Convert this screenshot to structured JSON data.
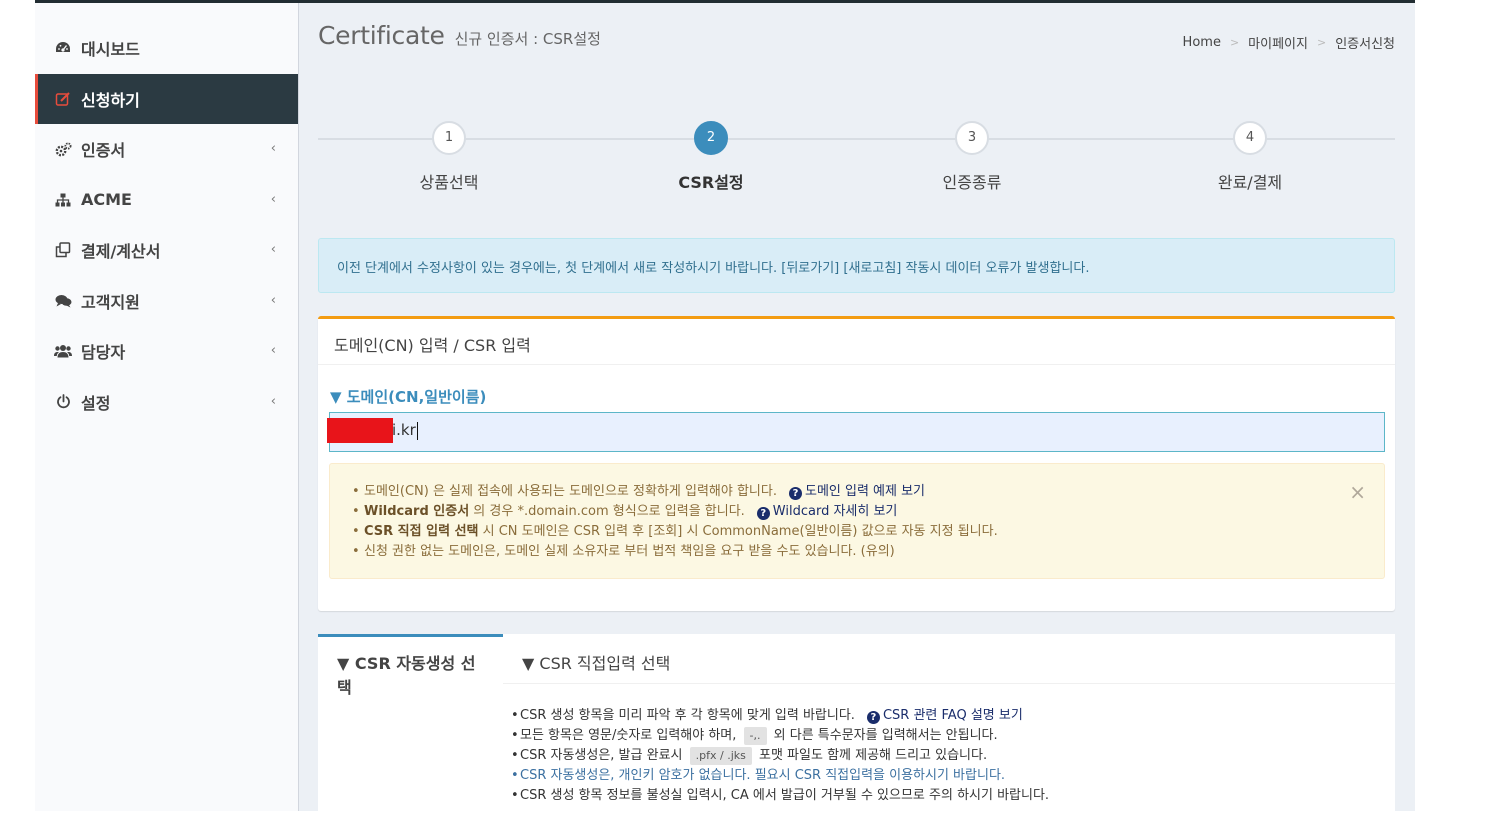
{
  "sidebar": {
    "items": [
      {
        "label": "대시보드",
        "icon": "dashboard-icon",
        "active": false,
        "has_submenu": false
      },
      {
        "label": "신청하기",
        "icon": "edit-icon",
        "active": true,
        "has_submenu": false
      },
      {
        "label": "인증서",
        "icon": "cogs-icon",
        "active": false,
        "has_submenu": true
      },
      {
        "label": "ACME",
        "icon": "sitemap-icon",
        "active": false,
        "has_submenu": true
      },
      {
        "label": "결제/계산서",
        "icon": "clone-icon",
        "active": false,
        "has_submenu": true
      },
      {
        "label": "고객지원",
        "icon": "comments-icon",
        "active": false,
        "has_submenu": true
      },
      {
        "label": "담당자",
        "icon": "users-icon",
        "active": false,
        "has_submenu": true
      },
      {
        "label": "설정",
        "icon": "power-icon",
        "active": false,
        "has_submenu": true
      }
    ],
    "chevron": "‹"
  },
  "header": {
    "title": "Certificate",
    "subtitle": "신규 인증서 : CSR설정",
    "breadcrumb": [
      "Home",
      "마이페이지",
      "인증서신청"
    ],
    "breadcrumb_sep": ">"
  },
  "stepper": {
    "steps": [
      {
        "num": "1",
        "label": "상품선택",
        "active": false
      },
      {
        "num": "2",
        "label": "CSR설정",
        "active": true
      },
      {
        "num": "3",
        "label": "인증종류",
        "active": false
      },
      {
        "num": "4",
        "label": "완료/결제",
        "active": false
      }
    ]
  },
  "info_alert": "이전 단계에서 수정사항이 있는 경우에는, 첫 단계에서 새로 작성하시기 바랍니다. [뒤로가기] [새로고침] 작동시 데이터 오류가 발생합니다.",
  "domain_box": {
    "header": "도메인(CN) 입력 / CSR 입력",
    "section_title": "▼ 도메인(CN,일반이름)",
    "input_value": "i.kr",
    "warning": {
      "line1_text": "도메인(CN) 은 실제 접속에 사용되는 도메인으로 정확하게 입력해야 합니다.",
      "line1_link": "도메인 입력 예제 보기",
      "line2_bold": "Wildcard 인증서",
      "line2_text": " 의 경우 *.domain.com 형식으로 입력을 합니다.",
      "line2_link": "Wildcard 자세히 보기",
      "line3_bold": "CSR 직접 입력 선택",
      "line3_text": " 시 CN 도메인은 CSR 입력 후 [조회] 시 CommonName(일반이름) 값으로 자동 지정 됩니다.",
      "line4_text": "신청 권한 없는 도메인은, 도메인 실제 소유자로 부터 법적 책임을 요구 받을 수도 있습니다. (유의)",
      "close": "×"
    }
  },
  "csr_tabs": {
    "tabs": [
      "▼ CSR 자동생성 선택",
      "▼ CSR 직접입력 선택"
    ],
    "content": {
      "line1_text": "CSR 생성 항목을 미리 파악 후 각 항목에 맞게 입력 바랍니다.",
      "line1_link": "CSR 관련 FAQ 설명 보기",
      "line2_a": "모든 항목은 영문/숫자로 입력해야 하며,",
      "line2_chip": "-,.",
      "line2_b": "외 다른 특수문자를 입력해서는 안됩니다.",
      "line3_a": "CSR 자동생성은, 발급 완료시",
      "line3_chip": ".pfx / .jks",
      "line3_b": "포맷 파일도 함께 제공해 드리고 있습니다.",
      "line4_text": "CSR 자동생성은, 개인키 암호가 없습니다. 필요시 CSR 직접입력을 이용하시기 바랍니다.",
      "line5_text": "CSR 생성 항목 정보를 불성실 입력시, CA 에서 발급이 거부될 수 있으므로 주의 하시기 바랍니다."
    }
  },
  "colors": {
    "accent": "#3c8dbc",
    "sidebar_active_bg": "#2b3a42",
    "sidebar_active_border": "#e74c3c",
    "box_top_border": "#f39c12",
    "redaction": "#e8141a"
  }
}
